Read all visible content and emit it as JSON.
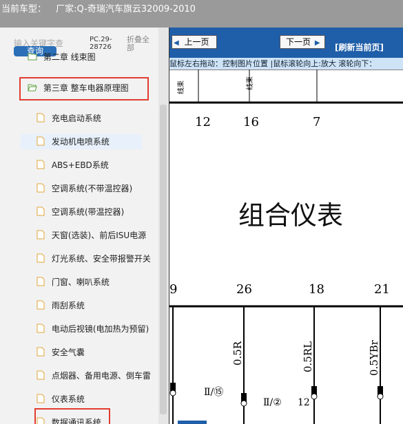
{
  "titlebar": {
    "label": "当前车型：",
    "maker": "厂家:Q-奇瑞汽车旗云32009-2010"
  },
  "search": {
    "placeholder": "输入关键字查",
    "button": "查询"
  },
  "code": "PC.29-\n28726",
  "collapse_all": "折叠全部",
  "tree": {
    "prev_chapter": "第二章 线束图",
    "chapter3": "第三章 整车电器原理图",
    "items": [
      "充电启动系统",
      "发动机电喷系统",
      "ABS+EBD系统",
      "空调系统(不带温控器)",
      "空调系统(带温控器)",
      "天窗(选装)、前后ISU电源",
      "灯光系统、安全带报警开关",
      "门窗、喇叭系统",
      "雨刮系统",
      "电动后视镜(电加热为预留)",
      "安全气囊",
      "点烟器、备用电源、倒车雷",
      "仪表系统",
      "数据通讯系统"
    ]
  },
  "viewer": {
    "prev": "上一页",
    "next": "下一页",
    "refresh": "[刷新当前页]",
    "hint": "鼠标左右拖动：控制图片位置 |鼠标滚轮向上:放大  滚轮向下：",
    "pins_top": [
      "12",
      "16",
      "7"
    ],
    "component": "组合仪表",
    "pins_bottom": [
      "9",
      "26",
      "18",
      "21"
    ],
    "wires": [
      "0.5R",
      "0.5RL",
      "0.5YBr"
    ],
    "labels": [
      "Ⅱ/⑮",
      "Ⅱ/②",
      "12"
    ]
  }
}
